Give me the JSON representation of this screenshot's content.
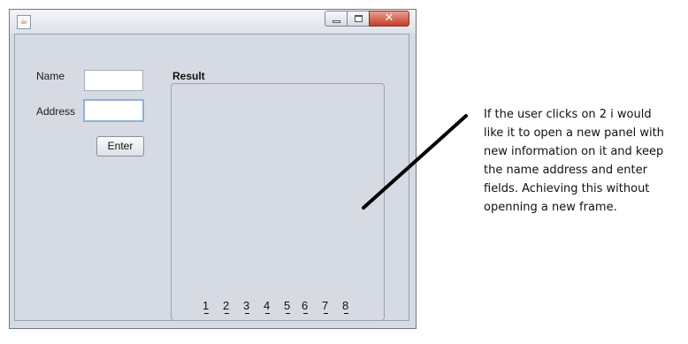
{
  "window": {
    "app_icon": "java-cup-icon",
    "buttons": [
      "minimize-icon",
      "maximize-icon",
      "close-icon"
    ]
  },
  "form": {
    "name_label": "Name",
    "name_value": "",
    "address_label": "Address",
    "address_value": "",
    "enter_button": "Enter"
  },
  "result": {
    "title": "Result",
    "pages": [
      "1",
      "2",
      "3",
      "4",
      "5",
      "6",
      "7",
      "8"
    ]
  },
  "annotation": {
    "note": "If the user clicks on 2 i would like it to open a new panel with new information on it and keep the name address and enter fields. Achieving this without openning a new frame.",
    "line_color": "#000000"
  }
}
